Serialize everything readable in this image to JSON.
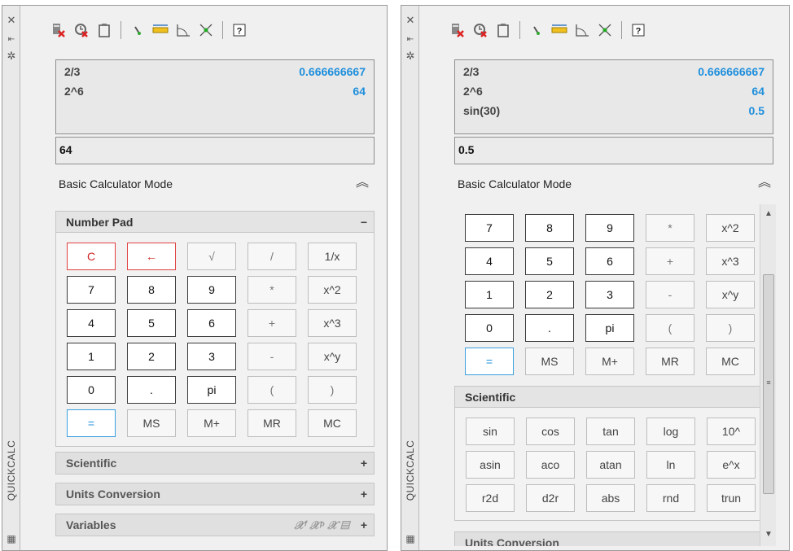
{
  "palette_title": "QUICKCALC",
  "icons": {
    "close": "close-icon",
    "autohide": "autohide-icon",
    "properties": "properties-icon",
    "calculator": "calculator-icon"
  },
  "toolbar": [
    "clear-icon",
    "clear-history-icon",
    "paste-to-command-line-icon",
    "get-coordinates-icon",
    "distance-icon",
    "angle-icon",
    "intersection-icon",
    "help-icon"
  ],
  "colors": {
    "accent": "#1e8fdc",
    "clear_key": "#d02020"
  },
  "left": {
    "history": [
      {
        "expr": "2/3",
        "result": "0.666666667"
      },
      {
        "expr": "2^6",
        "result": "64"
      }
    ],
    "input_value": "64",
    "mode_label": "Basic Calculator Mode",
    "number_pad": {
      "title": "Number Pad",
      "toggle": "−",
      "keys": [
        "C",
        "←",
        "√",
        "/",
        "1/x",
        "7",
        "8",
        "9",
        "*",
        "x^2",
        "4",
        "5",
        "6",
        "+",
        "x^3",
        "1",
        "2",
        "3",
        "-",
        "x^y",
        "0",
        ".",
        "pi",
        "(",
        ")",
        "=",
        "MS",
        "M+",
        "MR",
        "MC"
      ]
    },
    "scientific": {
      "title": "Scientific",
      "toggle": "+"
    },
    "units": {
      "title": "Units Conversion",
      "toggle": "+"
    },
    "variables": {
      "title": "Variables",
      "toggle": "+",
      "tools": "𝒳ᶠ 𝒳ᵖ 𝒳 ▤"
    }
  },
  "right": {
    "history": [
      {
        "expr": "2/3",
        "result": "0.666666667"
      },
      {
        "expr": "2^6",
        "result": "64"
      },
      {
        "expr": "sin(30)",
        "result": "0.5"
      }
    ],
    "input_value": "0.5",
    "mode_label": "Basic Calculator Mode",
    "number_pad_keys": [
      "7",
      "8",
      "9",
      "*",
      "x^2",
      "4",
      "5",
      "6",
      "+",
      "x^3",
      "1",
      "2",
      "3",
      "-",
      "x^y",
      "0",
      ".",
      "pi",
      "(",
      ")",
      "=",
      "MS",
      "M+",
      "MR",
      "MC"
    ],
    "scientific": {
      "title": "Scientific",
      "toggle": "−",
      "keys": [
        "sin",
        "cos",
        "tan",
        "log",
        "10^",
        "asin",
        "aco",
        "atan",
        "ln",
        "e^x",
        "r2d",
        "d2r",
        "abs",
        "rnd",
        "trun"
      ]
    },
    "units": {
      "title": "Units Conversion",
      "toggle": "+"
    }
  }
}
